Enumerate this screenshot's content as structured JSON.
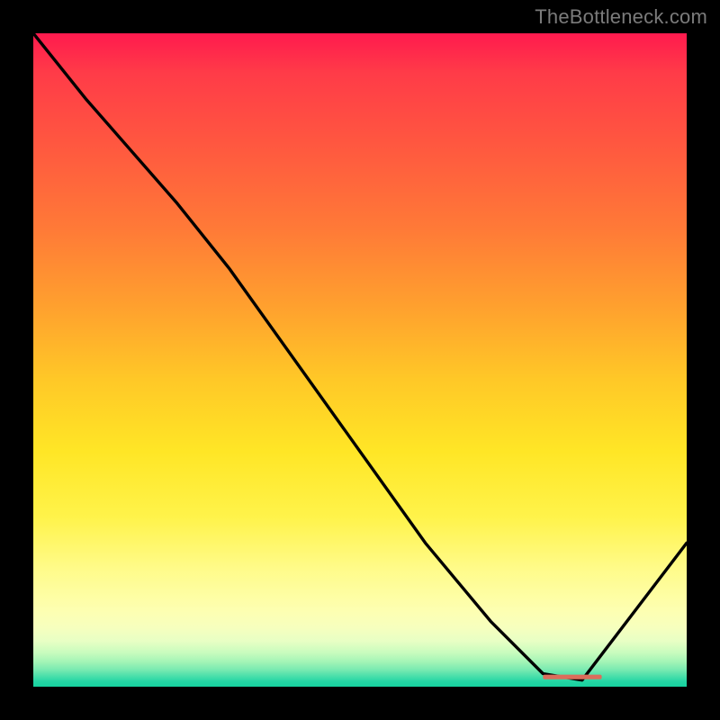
{
  "watermark": "TheBottleneck.com",
  "chart_data": {
    "type": "line",
    "title": "",
    "xlabel": "",
    "ylabel": "",
    "xlim": [
      0,
      100
    ],
    "ylim": [
      0,
      100
    ],
    "series": [
      {
        "name": "curve",
        "x": [
          0,
          8,
          22,
          30,
          40,
          50,
          60,
          70,
          78,
          84,
          100
        ],
        "values": [
          100,
          90,
          74,
          64,
          50,
          36,
          22,
          10,
          2,
          1,
          22
        ]
      }
    ],
    "marker": {
      "x": 82.5,
      "y": 1.5,
      "width": 9,
      "thickness": 0.7,
      "color": "#db6d5b"
    },
    "gradient_stops": [
      {
        "pct": 0,
        "color": "#ff1a4e"
      },
      {
        "pct": 18,
        "color": "#ff5a3f"
      },
      {
        "pct": 42,
        "color": "#ffa12e"
      },
      {
        "pct": 64,
        "color": "#ffe626"
      },
      {
        "pct": 88.5,
        "color": "#fdffb2"
      },
      {
        "pct": 100,
        "color": "#17d29f"
      }
    ]
  }
}
